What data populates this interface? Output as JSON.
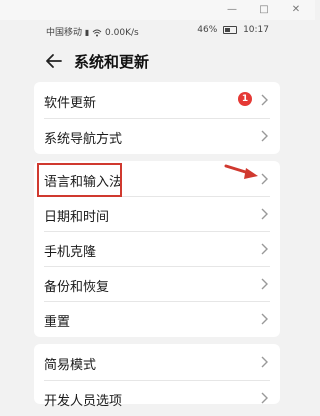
{
  "statusbar": {
    "carrier": "中国移动",
    "speed": "0.00K/s",
    "battery": "46%",
    "time": "10:17"
  },
  "header": {
    "title": "系统和更新"
  },
  "items": [
    {
      "label": "软件更新",
      "badge": "1"
    },
    {
      "label": "系统导航方式"
    },
    {
      "label": "语言和输入法"
    },
    {
      "label": "日期和时间"
    },
    {
      "label": "手机克隆"
    },
    {
      "label": "备份和恢复"
    },
    {
      "label": "重置"
    },
    {
      "label": "简易模式"
    },
    {
      "label": "开发人员选项"
    }
  ],
  "colors": {
    "highlight": "#d0392f",
    "badge": "#e53935"
  },
  "icons": [
    "minimize-icon",
    "maximize-icon",
    "close-icon",
    "wifi-icon",
    "battery-icon",
    "back-arrow-icon",
    "chevron-right-icon",
    "pointer-arrow-icon"
  ]
}
